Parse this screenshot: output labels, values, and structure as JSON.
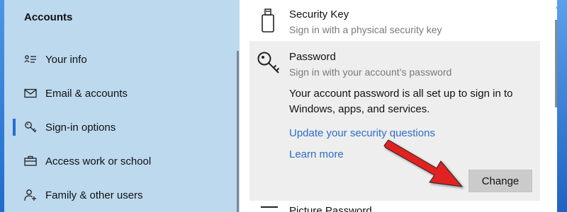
{
  "sidebar": {
    "title": "Accounts",
    "items": [
      {
        "label": "Your info",
        "icon": "person-card-icon"
      },
      {
        "label": "Email & accounts",
        "icon": "envelope-icon"
      },
      {
        "label": "Sign-in options",
        "icon": "key-icon",
        "selected": true
      },
      {
        "label": "Access work or school",
        "icon": "briefcase-icon"
      },
      {
        "label": "Family & other users",
        "icon": "add-person-icon"
      }
    ]
  },
  "content": {
    "security_key": {
      "title": "Security Key",
      "subtitle": "Sign in with a physical security key"
    },
    "password": {
      "title": "Password",
      "subtitle": "Sign in with your account’s password",
      "description": "Your account password is all set up to sign in to Windows, apps, and services.",
      "link_security_questions": "Update your security questions",
      "link_learn_more": "Learn more",
      "change_button": "Change"
    },
    "next_item": {
      "title": "Picture Password"
    }
  },
  "colors": {
    "sidebar_bg": "#bcd9ee",
    "accent": "#2a6ad2",
    "link": "#2b6cc7",
    "panel_bg": "#eeeeee",
    "button_bg": "#cbcbcb",
    "annotation_arrow": "#e02020"
  }
}
